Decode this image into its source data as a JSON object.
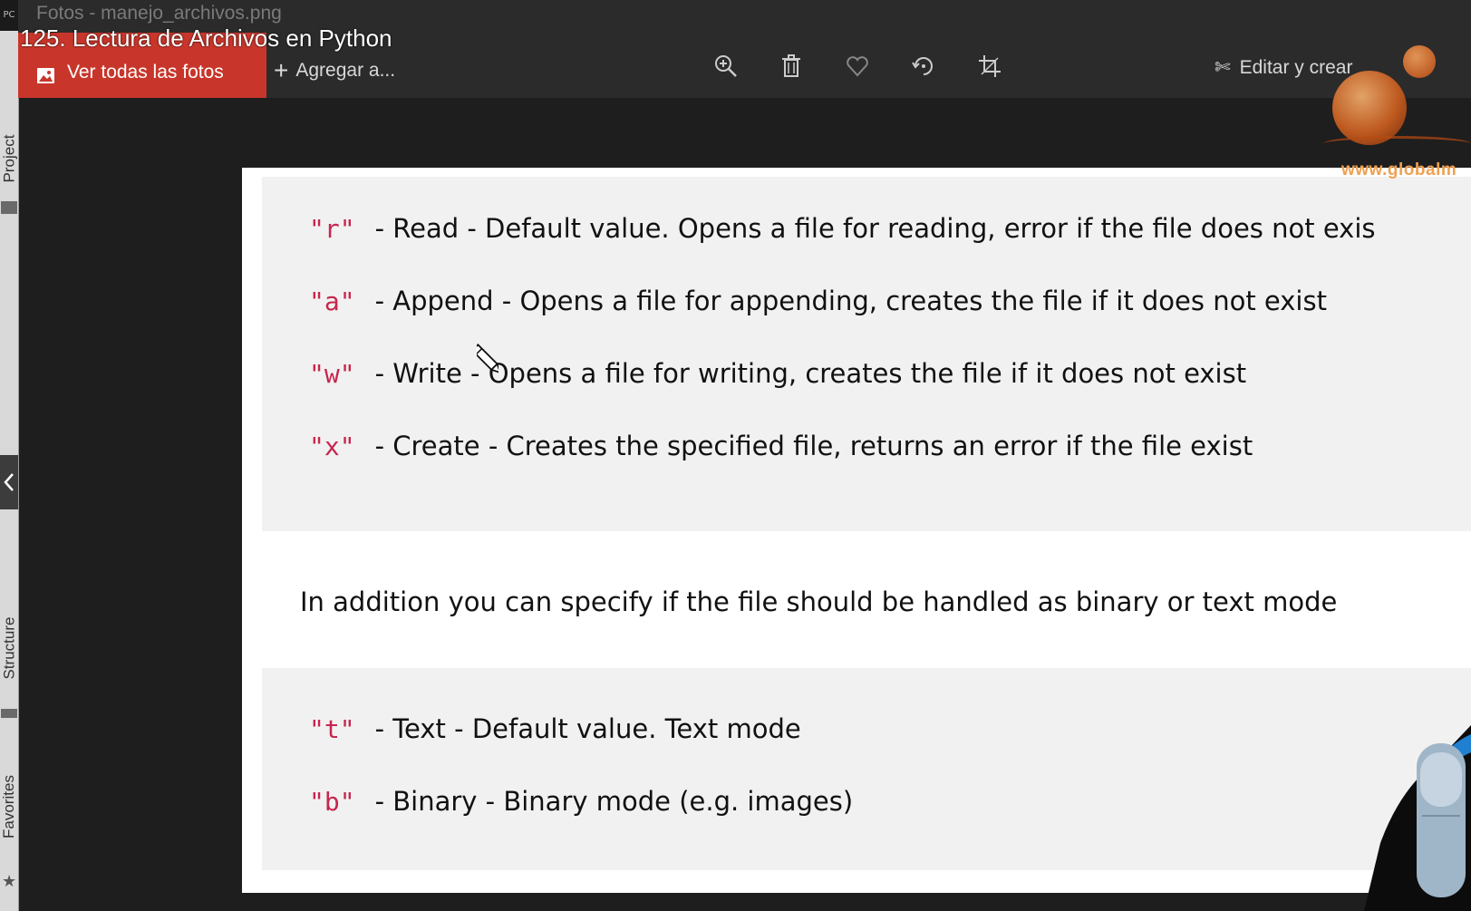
{
  "window": {
    "title": "Fotos - manejo_archivos.png",
    "video_title": "125. Lectura de Archivos en Python"
  },
  "ide": {
    "tabs": [
      "Project",
      "Structure",
      "Favorites"
    ]
  },
  "toolbar": {
    "all_photos_label": "Ver todas las fotos",
    "add_label": "Agregar a...",
    "edit_label": "Editar y crear",
    "icons": [
      "zoom-in-icon",
      "trash-icon",
      "heart-icon",
      "rotate-icon",
      "crop-icon"
    ]
  },
  "watermark": "www.globalm",
  "content": {
    "modes": [
      {
        "code": "\"r\"",
        "desc": "- Read - Default value. Opens a file for reading, error if the file does not exis"
      },
      {
        "code": "\"a\"",
        "desc": "- Append - Opens a file for appending, creates the file if it does not exist"
      },
      {
        "code": "\"w\"",
        "desc": "- Write - Opens a file for writing, creates the file if it does not exist"
      },
      {
        "code": "\"x\"",
        "desc": "- Create - Creates the specified file, returns an error if the file exist"
      }
    ],
    "paragraph": "In addition you can specify if the file should be handled as binary or text mode",
    "types": [
      {
        "code": "\"t\"",
        "desc": "- Text - Default value. Text mode"
      },
      {
        "code": "\"b\"",
        "desc": "- Binary - Binary mode (e.g. images)"
      }
    ]
  },
  "colors": {
    "accent": "#c8362b",
    "code": "#c7254e",
    "codebox": "#f1f1f1"
  }
}
